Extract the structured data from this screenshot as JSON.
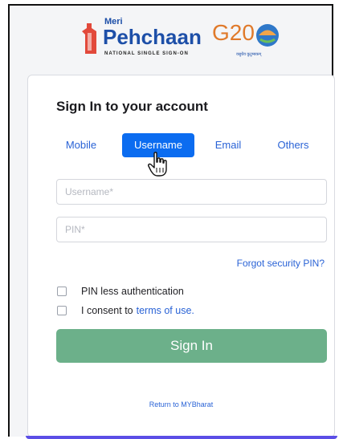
{
  "header": {
    "logo_small": "Meri",
    "logo_big": "Pehchaan",
    "logo_tagline": "NATIONAL SINGLE SIGN-ON",
    "g20_text": "G20",
    "g20_tagline": "वसुधैव कुटुम्बकम्"
  },
  "card": {
    "title": "Sign In to your account",
    "tabs": [
      {
        "label": "Mobile",
        "active": false
      },
      {
        "label": "Username",
        "active": true
      },
      {
        "label": "Email",
        "active": false
      },
      {
        "label": "Others",
        "active": false
      }
    ],
    "username_placeholder": "Username*",
    "pin_placeholder": "PIN*",
    "forgot_label": "Forgot security PIN?",
    "pinless_label": "PIN less authentication",
    "consent_label": "I consent to",
    "terms_label": "terms of use.",
    "signin_label": "Sign In",
    "return_label": "Return to MYBharat"
  },
  "colors": {
    "active_tab": "#0b6cf0",
    "link": "#2a63d6",
    "signin_button": "#6cb08a",
    "accent_bar": "#5b4ee6"
  }
}
